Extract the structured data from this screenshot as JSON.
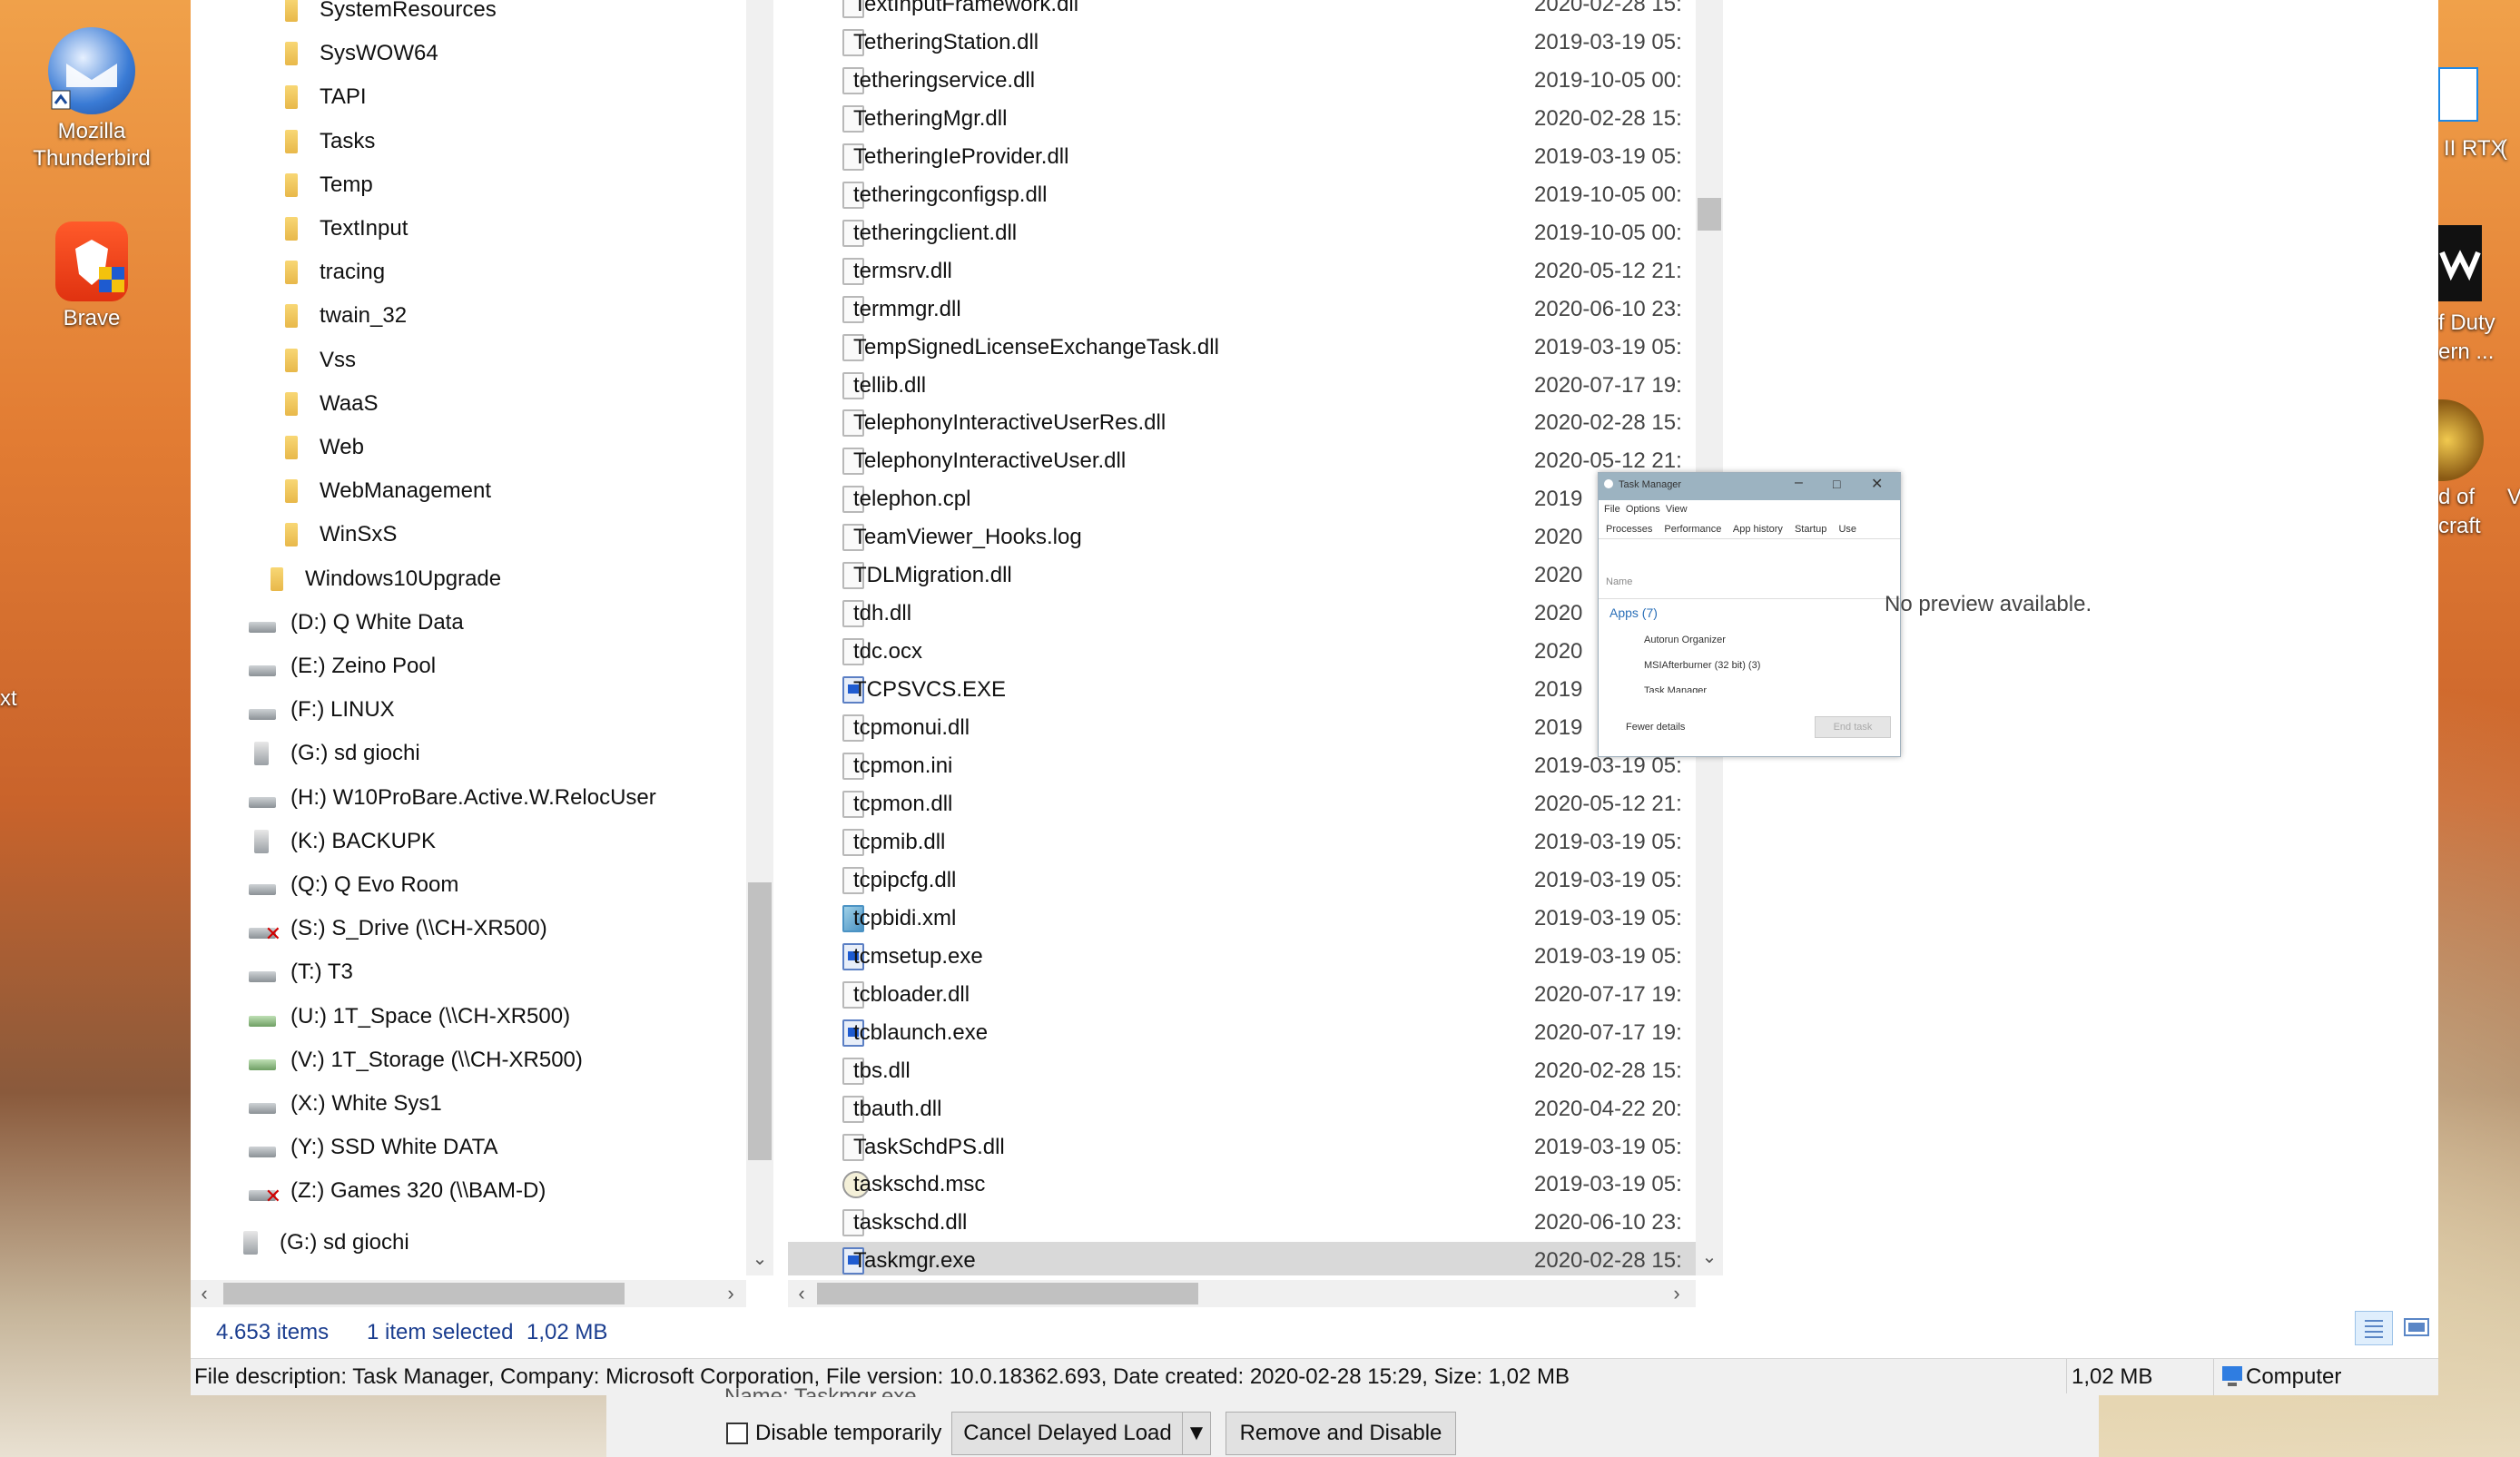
{
  "desktop": {
    "icons": [
      {
        "name": "Mozilla Thunderbird",
        "line1": "Mozilla",
        "line2": "Thunderbird"
      },
      {
        "name": "Brave",
        "line1": "Brave"
      }
    ],
    "left_edge_text": "xt",
    "right_icons": [
      {
        "line1": "II RTX",
        "line2": "("
      },
      {
        "line1": "f Duty",
        "line2": "ern ..."
      },
      {
        "line1": "d of",
        "line2": "craft"
      }
    ],
    "right_edge_char": "V"
  },
  "tree": {
    "folders": [
      "SystemResources",
      "SysWOW64",
      "TAPI",
      "Tasks",
      "Temp",
      "TextInput",
      "tracing",
      "twain_32",
      "Vss",
      "WaaS",
      "Web",
      "WebManagement",
      "WinSxS"
    ],
    "upgrade_folder": "Windows10Upgrade",
    "drives": [
      {
        "label": "(D:) Q White Data",
        "kind": "local"
      },
      {
        "label": "(E:) Zeino Pool",
        "kind": "local"
      },
      {
        "label": "(F:) LINUX",
        "kind": "local"
      },
      {
        "label": "(G:) sd giochi",
        "kind": "usb"
      },
      {
        "label": "(H:) W10ProBare.Active.W.RelocUser",
        "kind": "local"
      },
      {
        "label": "(K:) BACKUPK",
        "kind": "usb"
      },
      {
        "label": "(Q:) Q Evo Room",
        "kind": "local"
      },
      {
        "label": "(S:) S_Drive (\\\\CH-XR500)",
        "kind": "disconnected"
      },
      {
        "label": "(T:) T3",
        "kind": "local"
      },
      {
        "label": "(U:) 1T_Space (\\\\CH-XR500)",
        "kind": "net"
      },
      {
        "label": "(V:) 1T_Storage (\\\\CH-XR500)",
        "kind": "net"
      },
      {
        "label": "(X:) White Sys1",
        "kind": "local"
      },
      {
        "label": "(Y:) SSD White  DATA",
        "kind": "local"
      },
      {
        "label": "(Z:) Games 320 (\\\\BAM-D)",
        "kind": "disconnected"
      }
    ],
    "bottom_drive": "(G:) sd giochi"
  },
  "files": [
    {
      "name": "TextInputFramework.dll",
      "date": "2020-02-28 15:",
      "icon": "dll"
    },
    {
      "name": "TetheringStation.dll",
      "date": "2019-03-19 05:",
      "icon": "dll"
    },
    {
      "name": "tetheringservice.dll",
      "date": "2019-10-05 00:",
      "icon": "dll"
    },
    {
      "name": "TetheringMgr.dll",
      "date": "2020-02-28 15:",
      "icon": "dll"
    },
    {
      "name": "TetheringIeProvider.dll",
      "date": "2019-03-19 05:",
      "icon": "dll"
    },
    {
      "name": "tetheringconfigsp.dll",
      "date": "2019-10-05 00:",
      "icon": "dll"
    },
    {
      "name": "tetheringclient.dll",
      "date": "2019-10-05 00:",
      "icon": "dll"
    },
    {
      "name": "termsrv.dll",
      "date": "2020-05-12 21:",
      "icon": "dll"
    },
    {
      "name": "termmgr.dll",
      "date": "2020-06-10 23:",
      "icon": "dll"
    },
    {
      "name": "TempSignedLicenseExchangeTask.dll",
      "date": "2019-03-19 05:",
      "icon": "dll"
    },
    {
      "name": "tellib.dll",
      "date": "2020-07-17 19:",
      "icon": "dll"
    },
    {
      "name": "TelephonyInteractiveUserRes.dll",
      "date": "2020-02-28 15:",
      "icon": "dll"
    },
    {
      "name": "TelephonyInteractiveUser.dll",
      "date": "2020-05-12 21:",
      "icon": "dll"
    },
    {
      "name": "telephon.cpl",
      "date": "2019",
      "icon": "dll"
    },
    {
      "name": "TeamViewer_Hooks.log",
      "date": "2020",
      "icon": "log"
    },
    {
      "name": "TDLMigration.dll",
      "date": "2020",
      "icon": "dll"
    },
    {
      "name": "tdh.dll",
      "date": "2020",
      "icon": "dll"
    },
    {
      "name": "tdc.ocx",
      "date": "2020",
      "icon": "dll"
    },
    {
      "name": "TCPSVCS.EXE",
      "date": "2019",
      "icon": "exe"
    },
    {
      "name": "tcpmonui.dll",
      "date": "2019",
      "icon": "dll"
    },
    {
      "name": "tcpmon.ini",
      "date": "2019-03-19 05:",
      "icon": "ini"
    },
    {
      "name": "tcpmon.dll",
      "date": "2020-05-12 21:",
      "icon": "dll"
    },
    {
      "name": "tcpmib.dll",
      "date": "2019-03-19 05:",
      "icon": "dll"
    },
    {
      "name": "tcpipcfg.dll",
      "date": "2019-03-19 05:",
      "icon": "dll"
    },
    {
      "name": "tcpbidi.xml",
      "date": "2019-03-19 05:",
      "icon": "xml"
    },
    {
      "name": "tcmsetup.exe",
      "date": "2019-03-19 05:",
      "icon": "exe"
    },
    {
      "name": "tcbloader.dll",
      "date": "2020-07-17 19:",
      "icon": "dll"
    },
    {
      "name": "tcblaunch.exe",
      "date": "2020-07-17 19:",
      "icon": "exe"
    },
    {
      "name": "tbs.dll",
      "date": "2020-02-28 15:",
      "icon": "dll"
    },
    {
      "name": "tbauth.dll",
      "date": "2020-04-22 20:",
      "icon": "dll"
    },
    {
      "name": "TaskSchdPS.dll",
      "date": "2019-03-19 05:",
      "icon": "dll"
    },
    {
      "name": "taskschd.msc",
      "date": "2019-03-19 05:",
      "icon": "msc"
    },
    {
      "name": "taskschd.dll",
      "date": "2020-06-10 23:",
      "icon": "dll"
    },
    {
      "name": "Taskmgr.exe",
      "date": "2020-02-28 15:",
      "icon": "exe",
      "selected": true
    }
  ],
  "preview": {
    "no_preview": "No preview available.",
    "thumb": {
      "title": "Task Manager",
      "menu": [
        "File",
        "Options",
        "View"
      ],
      "tabs": [
        "Processes",
        "Performance",
        "App history",
        "Startup",
        "Use"
      ],
      "col_name": "Name",
      "group": "Apps (7)",
      "rows": [
        "Autorun Organizer",
        "MSIAfterburner (32 bit) (3)",
        "Task Manager"
      ],
      "fewer": "Fewer details",
      "end_task": "End task"
    }
  },
  "status": {
    "items": "4.653 items",
    "selected": "1 item selected",
    "size": "1,02 MB"
  },
  "infobar": {
    "description": "File description: Task Manager, Company: Microsoft Corporation, File version: 10.0.18362.693, Date created: 2020-02-28 15:29, Size: 1,02 MB",
    "size": "1,02 MB",
    "location": "Computer"
  },
  "dialog": {
    "name_partial": "Name:  Taskmgr.exe",
    "disable_temp": "Disable temporarily",
    "cancel_delayed": "Cancel Delayed Load",
    "remove_disable": "Remove and Disable"
  },
  "colors": {
    "selection": "#d9d9d9",
    "status_text": "#1a3d8f"
  }
}
